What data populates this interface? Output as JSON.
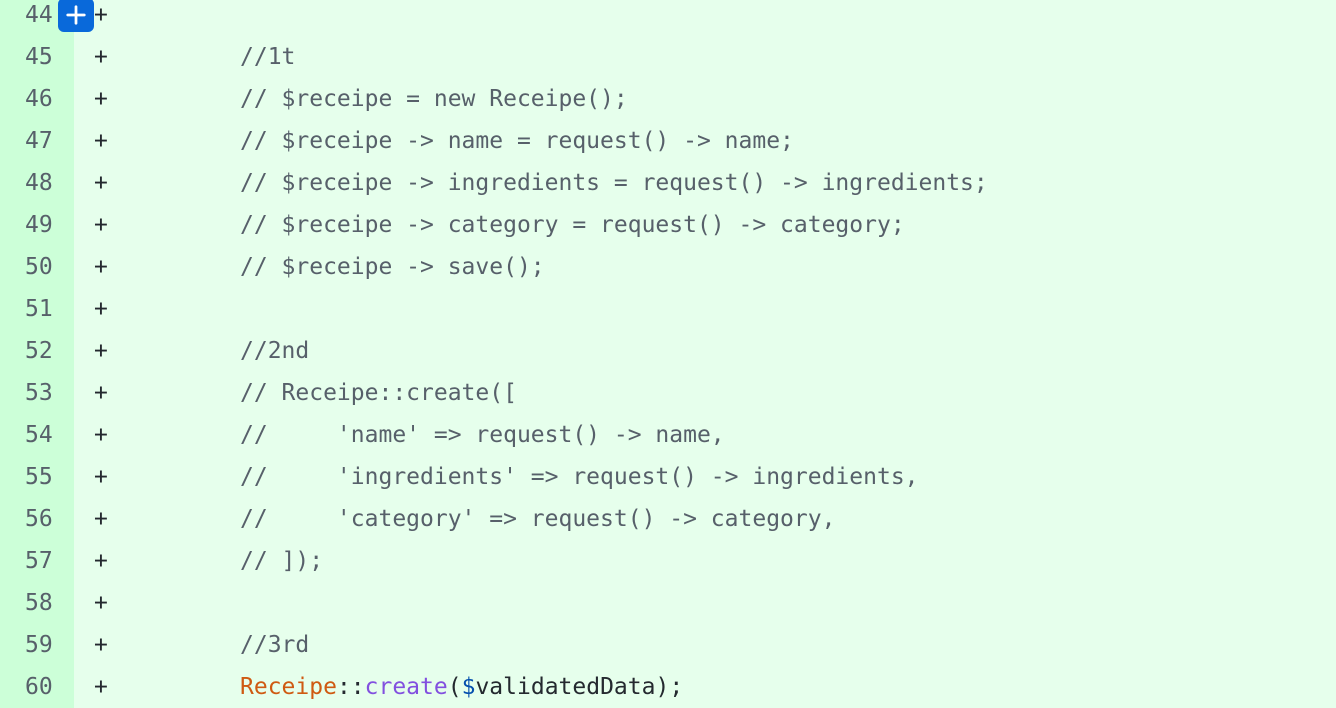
{
  "diff": {
    "marker": "+",
    "lines": [
      {
        "num": "44",
        "text": ""
      },
      {
        "num": "45",
        "text": "//1t"
      },
      {
        "num": "46",
        "text": "// $receipe = new Receipe();"
      },
      {
        "num": "47",
        "text": "// $receipe -> name = request() -> name;"
      },
      {
        "num": "48",
        "text": "// $receipe -> ingredients = request() -> ingredients;"
      },
      {
        "num": "49",
        "text": "// $receipe -> category = request() -> category;"
      },
      {
        "num": "50",
        "text": "// $receipe -> save();"
      },
      {
        "num": "51",
        "text": ""
      },
      {
        "num": "52",
        "text": "//2nd"
      },
      {
        "num": "53",
        "text": "// Receipe::create(["
      },
      {
        "num": "54",
        "text": "//     'name' => request() -> name,"
      },
      {
        "num": "55",
        "text": "//     'ingredients' => request() -> ingredients,"
      },
      {
        "num": "56",
        "text": "//     'category' => request() -> category,"
      },
      {
        "num": "57",
        "text": "// ]);"
      },
      {
        "num": "58",
        "text": ""
      },
      {
        "num": "59",
        "text": "//3rd"
      }
    ],
    "last_line": {
      "num": "60",
      "class_name": "Receipe",
      "op": "::",
      "method": "create",
      "open": "(",
      "dollar": "$",
      "var": "validatedData",
      "close": ");"
    },
    "add_comment_icon": "plus-icon",
    "colors": {
      "added_bg": "#e6ffec",
      "gutter_bg": "#ccffd8",
      "button_bg": "#0969da",
      "class_color": "#cf5a12",
      "method_color": "#8250df",
      "variable_color": "#0550ae"
    }
  }
}
